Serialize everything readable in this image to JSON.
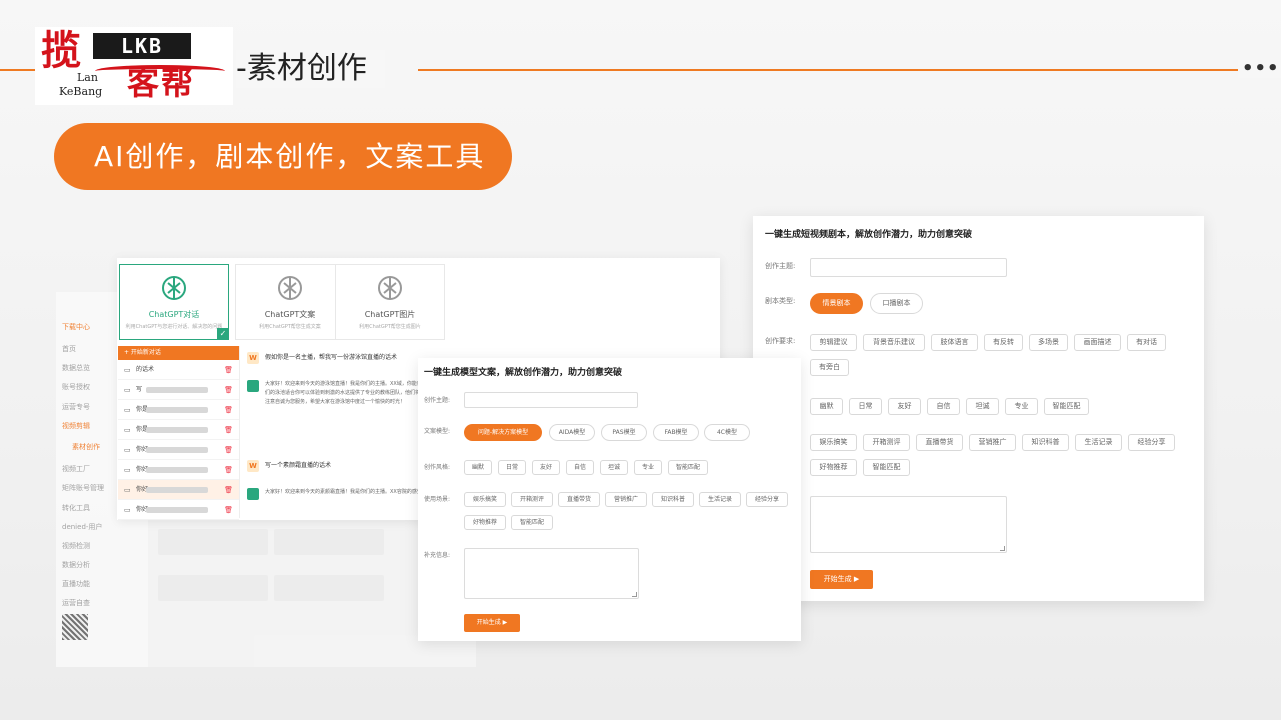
{
  "header": {
    "logo": {
      "zh_big": "揽",
      "en": "LKB",
      "lan": "Lan",
      "kebang": "KeBang",
      "zh_small": "客帮"
    },
    "title": "-素材创作",
    "more": "•••",
    "banner": "AI创作，剧本创作，文案工具"
  },
  "colors": {
    "accent": "#f07722",
    "gpt_green": "#2aa77e"
  },
  "dashboard": {
    "sidebar": [
      "下载中心",
      "首页",
      "数据总览",
      "账号授权",
      "运营专号",
      "视频剪辑",
      "素材创作",
      "视频工厂",
      "矩阵账号管理",
      "转化工具",
      "denied-用户",
      "视频检测",
      "数据分析",
      "直播功能",
      "运营自查"
    ]
  },
  "gpt": {
    "cards": [
      {
        "title": "ChatGPT对话",
        "sub": "利用ChatGPT与您进行对话、解决您的问题",
        "icon": "openai-icon",
        "active": true
      },
      {
        "title": "ChatGPT文案",
        "sub": "利用ChatGPT帮您生成文案",
        "icon": "openai-icon",
        "active": false
      },
      {
        "title": "ChatGPT图片",
        "sub": "利用ChatGPT帮您生成图片",
        "icon": "openai-icon",
        "active": false
      }
    ],
    "new_chat": "+ 开始新对话",
    "history": [
      "的话术",
      "写",
      "你是",
      "你是",
      "你好",
      "你好",
      "你好",
      "你好"
    ],
    "q1": "假如你是一名主播，帮我写一份游泳馆直播的话术",
    "a1": "大家好！欢迎来到今天的游泳馆直播！我是你们的主播。XX域，你能感受到这里充满了清新的水气和活力吗？我将在这里不同人群的需求。从儿童泳到深水泳，从休闲游泳到竞技的兴趣的设施。比如，我们的泳池适合你可以体验到刺激的水这提供了专业的教练团队，他们将帮助你提升游泳技巧。外，游泳馆还设有健身区、休闲区和健康养生区，让你在游都能有一个愉快的游泳体验。请遵守游泳馆的规定，注意自诚为您服务，希望大家在游泳馆中度过一个愉快的时光！",
    "q2": "写一个素颜霜直播的话术",
    "a2": "大家好！欢迎来到今天的素颜霜直播！我是你们的主播。XX容院的感受呢，这里充满了舒适和优雅的氛围。专业的美容来，让我们带您一下我们的护理室。这是一个设计精美的空"
  },
  "script_form": {
    "title": "一键生成短视频剧本，解放创作潜力，助力创意突破",
    "topic_label": "创作主题:",
    "type_label": "剧本类型:",
    "types": [
      {
        "label": "情景剧本",
        "on": true
      },
      {
        "label": "口播剧本",
        "on": false
      }
    ],
    "req_label": "创作要求:",
    "reqs": [
      "剪辑建议",
      "背景音乐建议",
      "肢体语言",
      "有反转",
      "多场景",
      "画面描述",
      "有对话",
      "有旁白"
    ],
    "styles": [
      "幽默",
      "日常",
      "友好",
      "自信",
      "坦诚",
      "专业",
      "智能匹配"
    ],
    "scenes": [
      "娱乐搞笑",
      "开箱测评",
      "直播带货",
      "营销推广",
      "知识科普",
      "生活记录",
      "经验分享",
      "好物推荐",
      "智能匹配"
    ],
    "submit": "开始生成 ▶"
  },
  "copy_form": {
    "title": "一键生成模型文案，解放创作潜力，助力创意突破",
    "topic_label": "创作主题:",
    "model_label": "文案模型:",
    "models": [
      {
        "label": "问题-解决方案模型",
        "on": true
      },
      {
        "label": "AIDA模型",
        "on": false
      },
      {
        "label": "PAS模型",
        "on": false
      },
      {
        "label": "FAB模型",
        "on": false
      },
      {
        "label": "4C模型",
        "on": false
      }
    ],
    "style_label": "创作风格:",
    "styles": [
      "幽默",
      "日常",
      "友好",
      "自信",
      "坦诚",
      "专业",
      "智能匹配"
    ],
    "scene_label": "使用场景:",
    "scenes": [
      "娱乐搞笑",
      "开箱测评",
      "直播带货",
      "营销推广",
      "知识科普",
      "生活记录",
      "经验分享",
      "好物推荐",
      "智能匹配"
    ],
    "extra_label": "补充信息:",
    "submit": "开始生成 ▶"
  }
}
